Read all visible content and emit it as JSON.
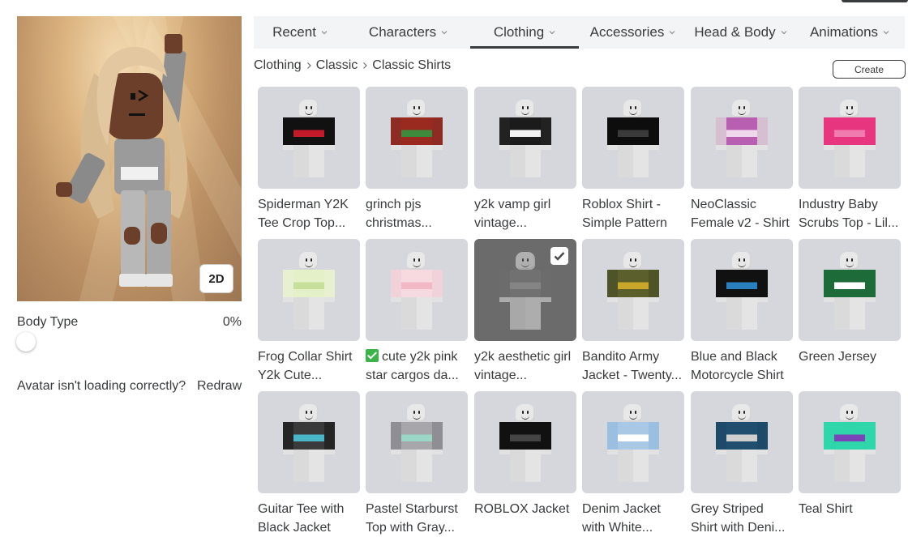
{
  "tabs": [
    {
      "label": "Recent",
      "active": false
    },
    {
      "label": "Characters",
      "active": false
    },
    {
      "label": "Clothing",
      "active": true
    },
    {
      "label": "Accessories",
      "active": false
    },
    {
      "label": "Head & Body",
      "active": false
    },
    {
      "label": "Animations",
      "active": false
    }
  ],
  "breadcrumb": [
    "Clothing",
    "Classic",
    "Classic Shirts"
  ],
  "create_label": "Create",
  "avatar": {
    "view_toggle_label": "2D",
    "body_type_label": "Body Type",
    "body_type_value": "0%",
    "body_type_level": 0,
    "issue_text": "Avatar isn't loading correctly?",
    "redraw_label": "Redraw"
  },
  "items": [
    {
      "name": "Spiderman Y2K Tee Crop Top...",
      "torso": "#111111",
      "accent": "#c41b2a",
      "arms": "#111111",
      "selected": false,
      "emoji": false
    },
    {
      "name": "grinch pjs christmas...",
      "torso": "#9a2a20",
      "accent": "#3d8a3c",
      "arms": "#8e2b22",
      "selected": false,
      "emoji": false
    },
    {
      "name": "y2k vamp girl vintage...",
      "torso": "#1b1b1b",
      "accent": "#f2f2f2",
      "arms": "#222222",
      "selected": false,
      "emoji": false
    },
    {
      "name": "Roblox Shirt - Simple Pattern",
      "torso": "#0d0d0d",
      "accent": "#3a3a3a",
      "arms": "#0d0d0d",
      "selected": false,
      "emoji": false
    },
    {
      "name": "NeoClassic Female v2 - Shirt",
      "torso": "#b95fb2",
      "accent": "#f0d8ec",
      "arms": "#d7bfd2",
      "selected": false,
      "emoji": false
    },
    {
      "name": "Industry Baby Scrubs Top - Lil...",
      "torso": "#e8357f",
      "accent": "#f07bae",
      "arms": "#e8357f",
      "selected": false,
      "emoji": false
    },
    {
      "name": "Frog Collar Shirt Y2k Cute...",
      "torso": "#e4f0c8",
      "accent": "#c7df9a",
      "arms": "#e8f0d2",
      "selected": false,
      "emoji": false
    },
    {
      "name": "cute y2k pink star cargos da...",
      "torso": "#f7d9e0",
      "accent": "#f3b8c6",
      "arms": "#f2d2da",
      "selected": false,
      "emoji": true
    },
    {
      "name": "y2k aesthetic girl vintage...",
      "torso": "#777777",
      "accent": "#9a9a9a",
      "arms": "#6e6e6e",
      "selected": true,
      "emoji": false
    },
    {
      "name": "Bandito Army Jacket - Twenty...",
      "torso": "#5a5f2c",
      "accent": "#c9a72a",
      "arms": "#4e5428",
      "selected": false,
      "emoji": false
    },
    {
      "name": "Blue and Black Motorcycle Shirt",
      "torso": "#111111",
      "accent": "#2a7fbf",
      "arms": "#111111",
      "selected": false,
      "emoji": false
    },
    {
      "name": "Green Jersey",
      "torso": "#1e6b3a",
      "accent": "#ffffff",
      "arms": "#1e6b3a",
      "selected": false,
      "emoji": false
    },
    {
      "name": "Guitar Tee with Black Jacket",
      "torso": "#3a3a3a",
      "accent": "#49b7c8",
      "arms": "#252525",
      "selected": false,
      "emoji": false
    },
    {
      "name": "Pastel Starburst Top with Gray...",
      "torso": "#a6a6ab",
      "accent": "#9ad7c4",
      "arms": "#8e8e94",
      "selected": false,
      "emoji": false
    },
    {
      "name": "ROBLOX Jacket",
      "torso": "#111111",
      "accent": "#444444",
      "arms": "#111111",
      "selected": false,
      "emoji": false
    },
    {
      "name": "Denim Jacket with White...",
      "torso": "#a9c8e6",
      "accent": "#ffffff",
      "arms": "#9bbfe0",
      "selected": false,
      "emoji": false
    },
    {
      "name": "Grey Striped Shirt with Deni...",
      "torso": "#1f4e6e",
      "accent": "#cfcfcf",
      "arms": "#1d4a68",
      "selected": false,
      "emoji": false
    },
    {
      "name": "Teal Shirt",
      "torso": "#2fd6a9",
      "accent": "#7a44b8",
      "arms": "#2fd6a9",
      "selected": false,
      "emoji": false
    }
  ]
}
